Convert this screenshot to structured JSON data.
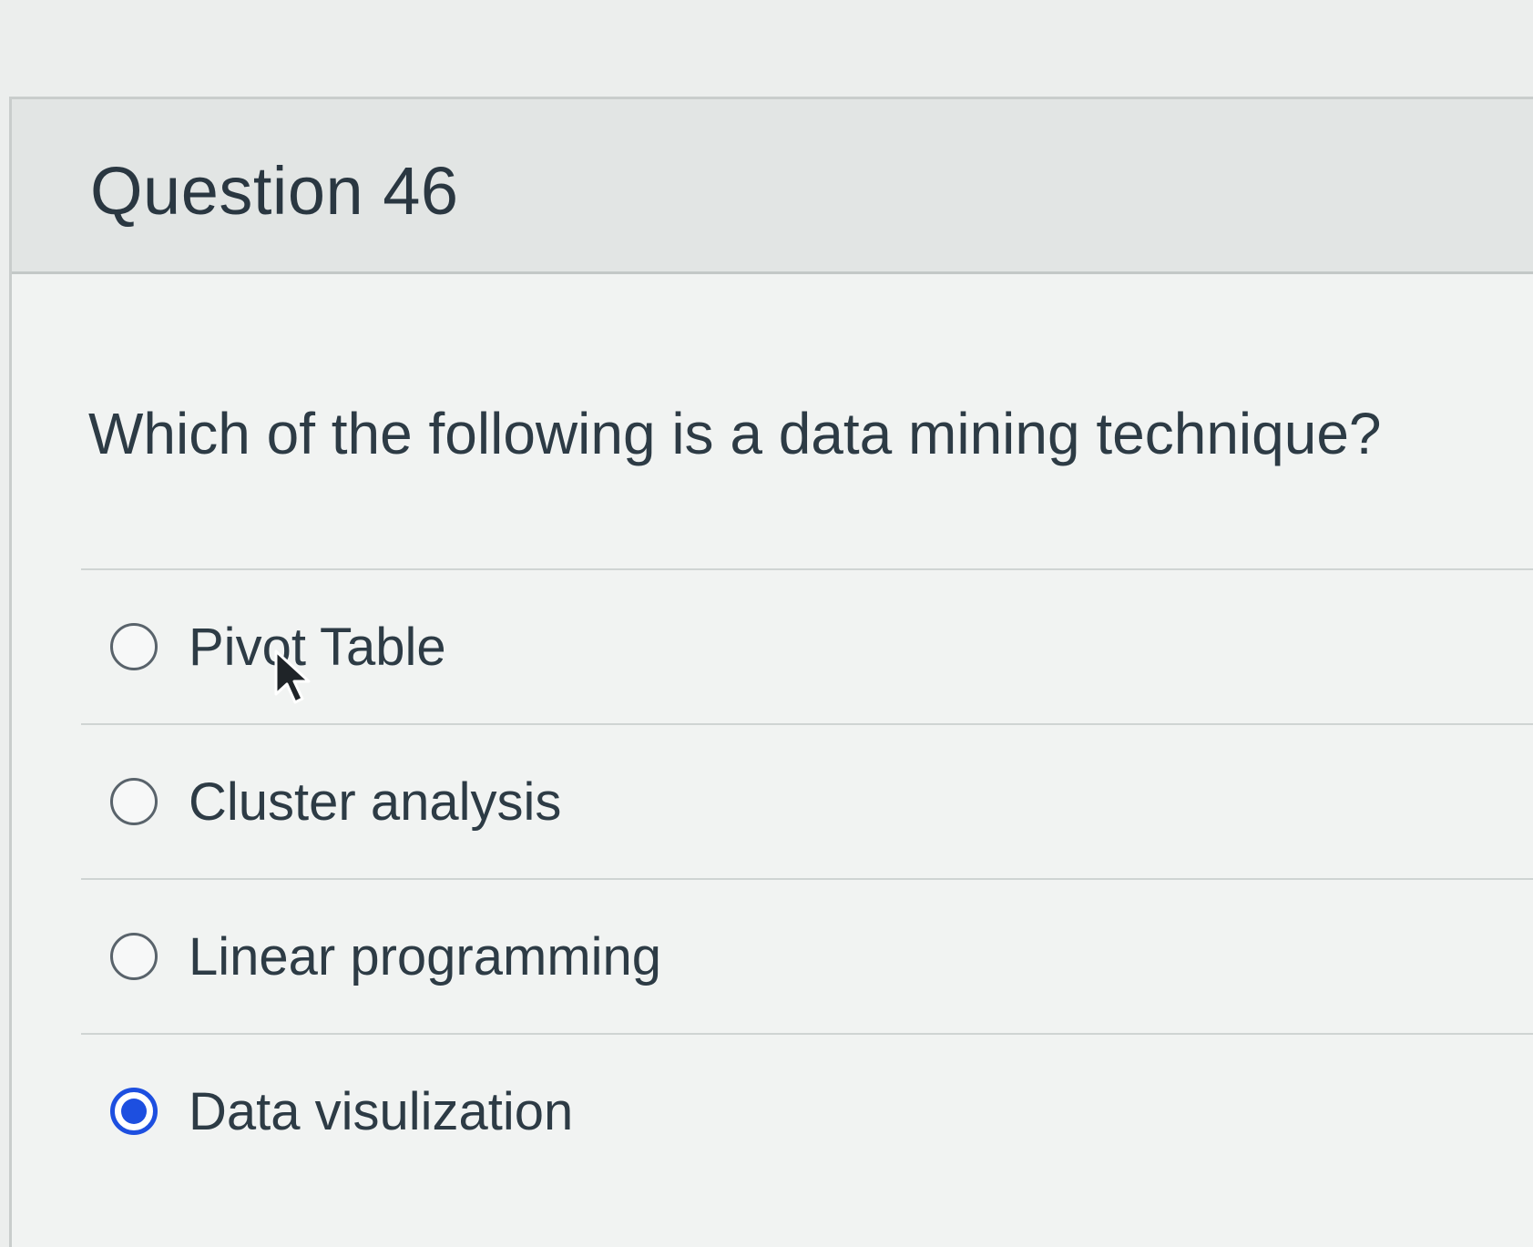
{
  "question": {
    "title": "Question 46",
    "prompt": "Which of the following is a data mining technique?"
  },
  "answers": [
    {
      "label": "Pivot Table",
      "selected": false
    },
    {
      "label": "Cluster analysis",
      "selected": false
    },
    {
      "label": "Linear programming",
      "selected": false
    },
    {
      "label": "Data visulization",
      "selected": true
    }
  ],
  "colors": {
    "selected_radio": "#1d4fe0",
    "text": "#2d3b45",
    "header_background": "#e2e5e4"
  },
  "icons": {
    "pointer": "mouse-pointer-icon"
  }
}
